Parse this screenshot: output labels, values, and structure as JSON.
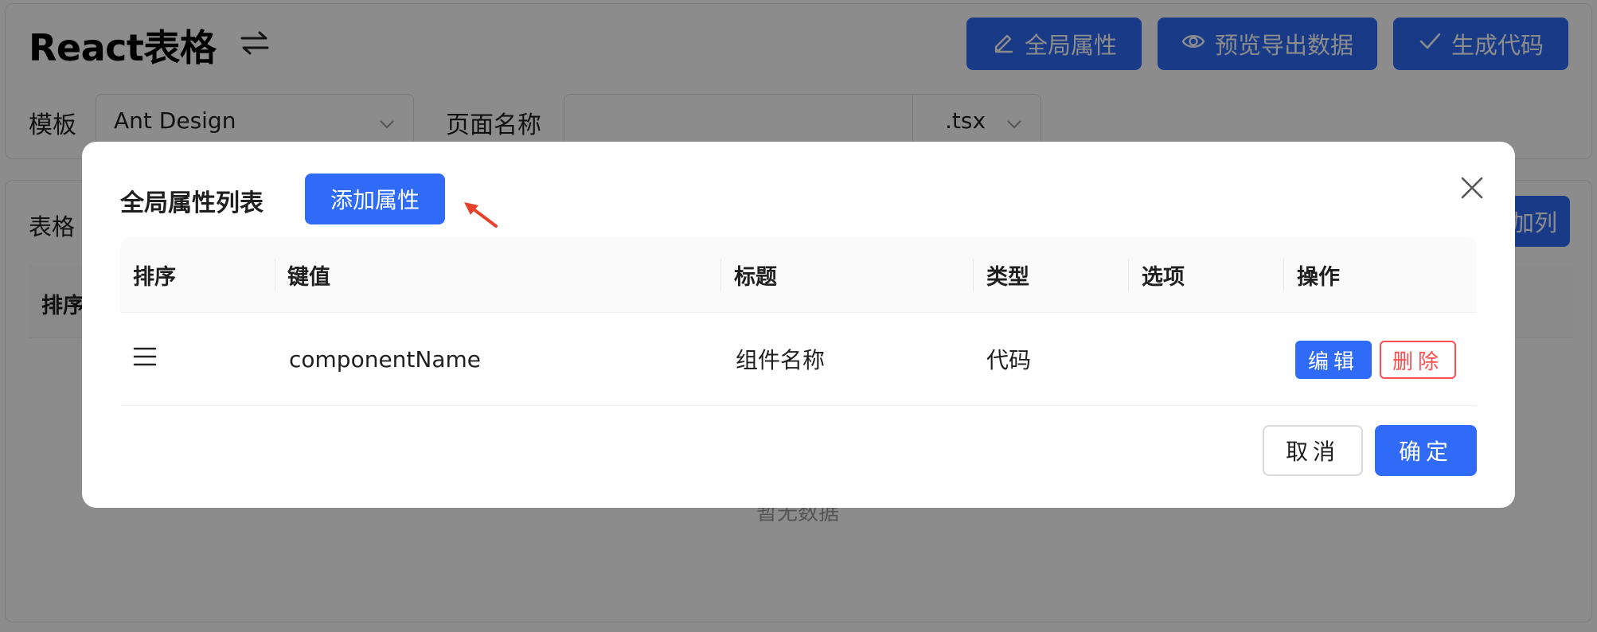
{
  "page": {
    "title": "React表格",
    "toolbar": {
      "global_props": "全局属性",
      "preview_export": "预览导出数据",
      "generate_code": "生成代码"
    },
    "form": {
      "template_label": "模板",
      "template_value": "Ant Design",
      "page_name_label": "页面名称",
      "page_name_value": "",
      "extension_value": ".tsx"
    },
    "table_section": {
      "title_partial": "表格",
      "first_col_partial": "排序",
      "empty_text_partial": "暂无数据",
      "right_button_partial": "加列"
    }
  },
  "modal": {
    "title": "全局属性列表",
    "add_button": "添加属性",
    "columns": [
      "排序",
      "键值",
      "标题",
      "类型",
      "选项",
      "操作"
    ],
    "rows": [
      {
        "key": "componentName",
        "title": "组件名称",
        "type": "代码",
        "options": "",
        "edit_label": "编辑",
        "delete_label": "删除"
      }
    ],
    "footer": {
      "cancel": "取消",
      "ok": "确定"
    }
  },
  "colors": {
    "primary": "#2f6bf6",
    "danger": "#ff4d4f",
    "arrow": "#e8412c",
    "overlay": "rgba(0,0,0,0.45)"
  },
  "icons": {
    "title_toggle": "swap-arrows-icon",
    "global_props": "edit-pencil-icon",
    "preview": "eye-icon",
    "generate": "check-icon",
    "select_arrow": "chevron-down-icon",
    "close": "close-icon",
    "drag": "drag-handle-icon",
    "annotation": "red-arrow-icon"
  }
}
